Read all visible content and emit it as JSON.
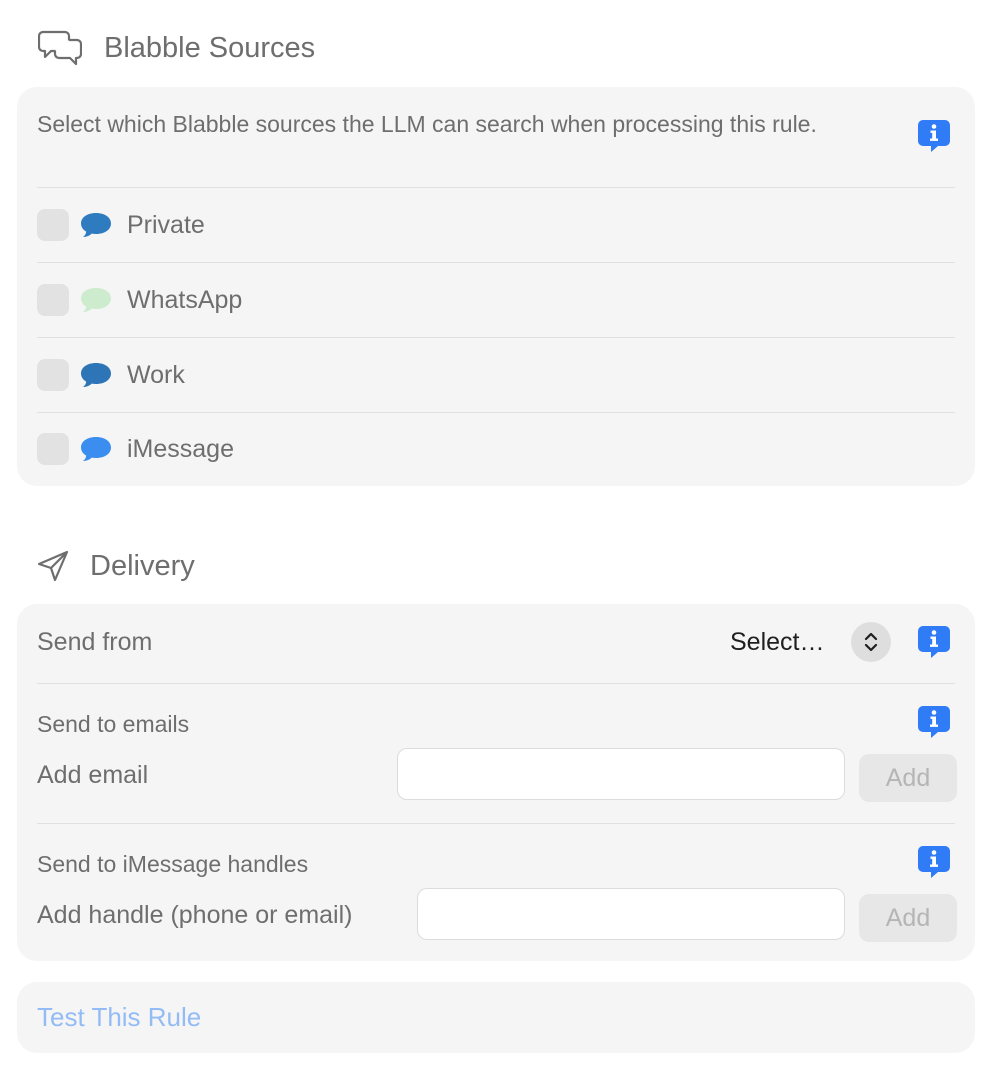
{
  "sources_section": {
    "title": "Blabble Sources",
    "icon": "chat-bubbles-icon",
    "description": "Select which Blabble sources the LLM can search when processing this rule.",
    "items": [
      {
        "label": "Private",
        "checked": false,
        "bubble_color": "#2f7bbf"
      },
      {
        "label": "WhatsApp",
        "checked": false,
        "bubble_color": "#cdeccd"
      },
      {
        "label": "Work",
        "checked": false,
        "bubble_color": "#2d75b6"
      },
      {
        "label": "iMessage",
        "checked": false,
        "bubble_color": "#3b8df0"
      }
    ]
  },
  "delivery_section": {
    "title": "Delivery",
    "icon": "paper-plane-icon",
    "send_from": {
      "label": "Send from",
      "value": "Select…"
    },
    "emails": {
      "label": "Send to emails",
      "field_label": "Add email",
      "value": "",
      "placeholder": "",
      "add_label": "Add"
    },
    "imessage": {
      "label": "Send to iMessage handles",
      "field_label": "Add handle (phone or email)",
      "value": "",
      "placeholder": "",
      "add_label": "Add"
    }
  },
  "test": {
    "label": "Test This Rule"
  },
  "colors": {
    "info_blue": "#2f7cf6",
    "link_disabled": "#93bcf6",
    "card_bg": "#f5f5f5"
  }
}
